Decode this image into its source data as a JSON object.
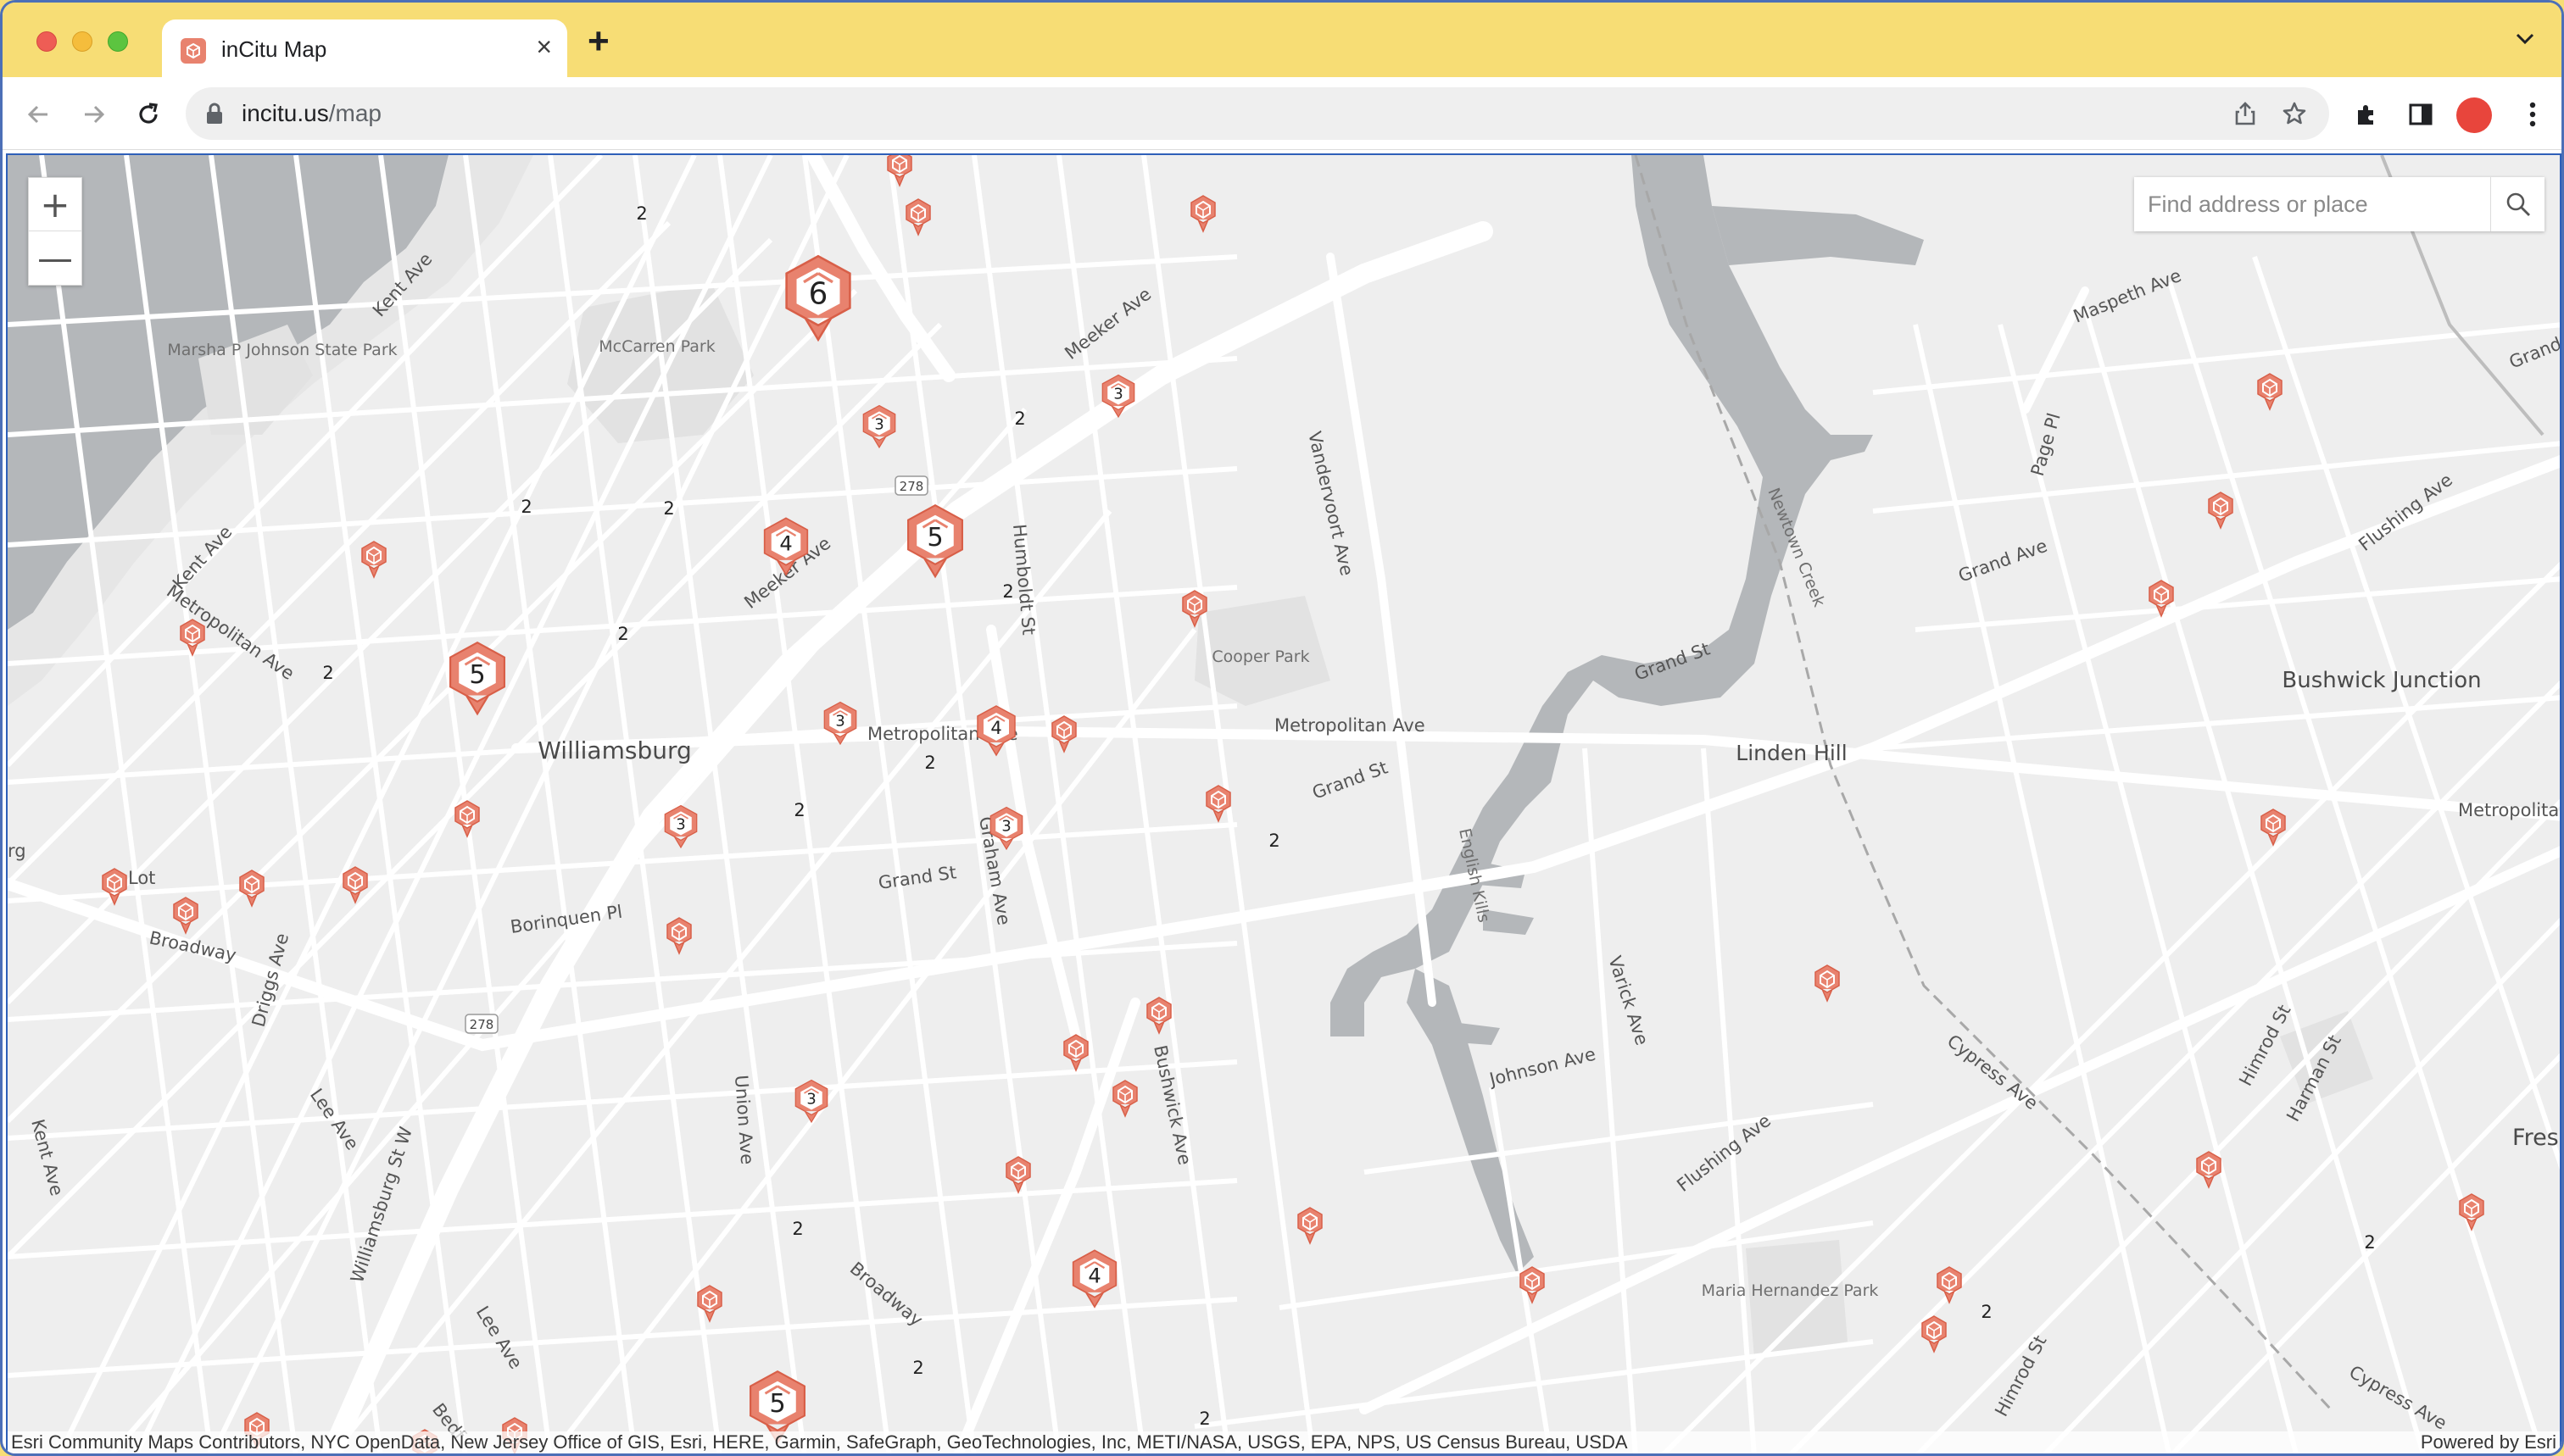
{
  "window": {
    "tab_title": "inCitu Map",
    "url_domain": "incitu.us",
    "url_path": "/map"
  },
  "toolbar": {
    "icons": [
      "back-icon",
      "forward-icon",
      "reload-icon",
      "lock-icon",
      "share-icon",
      "bookmark-star-icon",
      "extensions-icon",
      "side-panel-icon",
      "profile-avatar",
      "menu-icon"
    ]
  },
  "map": {
    "search_placeholder": "Find address or place",
    "zoom_in": "+",
    "zoom_out": "—",
    "attribution": "Esri Community Maps Contributors, NYC OpenData, New Jersey Office of GIS, Esri, HERE, Garmin, SafeGraph, GeoTechnologies, Inc, METI/NASA, USGS, EPA, NPS, US Census Bureau, USDA",
    "powered_by": "Powered by Esri",
    "neighborhoods": [
      "Williamsburg",
      "Linden Hill",
      "Bushwick Junction",
      "Fres"
    ],
    "parks": [
      "Marsha P Johnson State Park",
      "McCarren Park",
      "Cooper Park",
      "Maria Hernandez Park"
    ],
    "waterways": [
      "Newtown Creek",
      "English Kills"
    ],
    "streets": [
      "Kent Ave",
      "Meeker Ave",
      "Maspeth Ave",
      "Grand Ave",
      "Flushing Ave",
      "Vandervoort Ave",
      "Page Pl",
      "Humboldt St",
      "Metropolitan Ave",
      "Grand St",
      "Graham Ave",
      "Borinquen Pl",
      "Broadway",
      "Driggs Ave",
      "Union Ave",
      "Bushwick Ave",
      "Johnson Ave",
      "Varick Ave",
      "Cypress Ave",
      "Himrod St",
      "Harman St",
      "Lee Ave",
      "Williamsburg St W",
      "Bedf",
      "Lot",
      "rg",
      "Metropolita",
      "St",
      "Cypress Ave",
      "Himrod St"
    ],
    "route_shields": [
      "278",
      "278"
    ],
    "clusters": [
      "6",
      "5",
      "5",
      "5",
      "5",
      "4",
      "4",
      "4",
      "3",
      "3",
      "3",
      "3",
      "3",
      "3",
      "3",
      "2",
      "2",
      "2",
      "2",
      "2",
      "2",
      "2",
      "2",
      "2",
      "2",
      "2",
      "2",
      "2",
      "2",
      "2"
    ]
  },
  "colors": {
    "marker": "#e8826e",
    "marker_stroke": "#d85f48",
    "map_bg": "#eeeeee",
    "road": "#ffffff",
    "water": "#b7b9bc",
    "titlebar": "#f7dd75"
  }
}
